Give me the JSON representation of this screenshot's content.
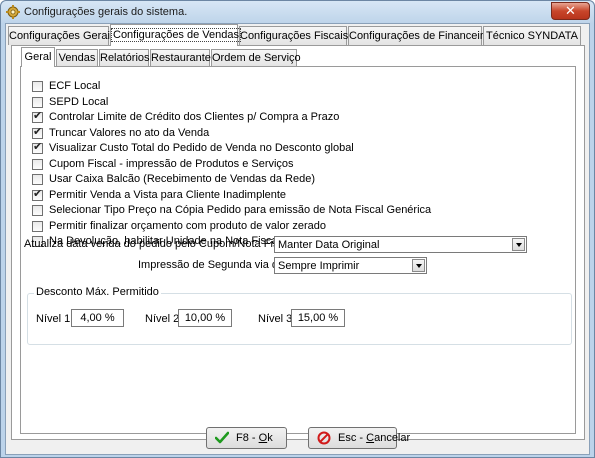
{
  "window": {
    "title": "Configurações gerais do sistema.",
    "close_label": "✕"
  },
  "tabs": [
    {
      "label": "Configurações Gerais"
    },
    {
      "label": "Configurações de Vendas"
    },
    {
      "label": "Configurações Fiscais"
    },
    {
      "label": "Configurações de Financeiro"
    },
    {
      "label": "Técnico SYNDATA"
    }
  ],
  "subtabs": [
    {
      "label": "Geral"
    },
    {
      "label": "Vendas"
    },
    {
      "label": "Relatórios"
    },
    {
      "label": "Restaurante"
    },
    {
      "label": "Ordem de Serviço"
    }
  ],
  "options": [
    {
      "label": "ECF Local",
      "checked": false
    },
    {
      "label": "SEPD Local",
      "checked": false
    },
    {
      "label": "Controlar Limite de Crédito dos Clientes p/ Compra a Prazo",
      "checked": true
    },
    {
      "label": "Truncar Valores no ato da Venda",
      "checked": true
    },
    {
      "label": "Visualizar Custo Total do Pedido de Venda no Desconto global",
      "checked": true
    },
    {
      "label": "Cupom Fiscal - impressão de Produtos e Serviços",
      "checked": false
    },
    {
      "label": "Usar Caixa Balcão (Recebimento de Vendas da Rede)",
      "checked": false
    },
    {
      "label": "Permitir Venda a Vista para Cliente Inadimplente",
      "checked": true
    },
    {
      "label": "Selecionar Tipo Preço na Cópia Pedido para emissão de Nota Fiscal Genérica",
      "checked": false
    },
    {
      "label": "Permitir finalizar orçamento com produto de valor zerado",
      "checked": false
    },
    {
      "label": "Na Devolução, habilitar Unidade na Nota Fiscal Genérica",
      "checked": false
    }
  ],
  "date_update": {
    "label": "Atualiza data venda do pedido pelo Cupom/Nota Fiscal:",
    "value": "Manter Data Original"
  },
  "tef_print": {
    "label": "Impressão de Segunda via do TEF:",
    "value": "Sempre Imprimir"
  },
  "discount": {
    "title": "Desconto Máx. Permitido",
    "levels": [
      {
        "label": "Nível 1",
        "value": "4,00 %"
      },
      {
        "label": "Nível 2",
        "value": "10,00 %"
      },
      {
        "label": "Nível 3",
        "value": "15,00 %"
      }
    ]
  },
  "buttons": {
    "ok": {
      "prefix": "F8 - ",
      "hotkey": "O",
      "rest": "k"
    },
    "cancel": {
      "prefix": "Esc - ",
      "hotkey": "C",
      "rest": "ancelar"
    }
  }
}
